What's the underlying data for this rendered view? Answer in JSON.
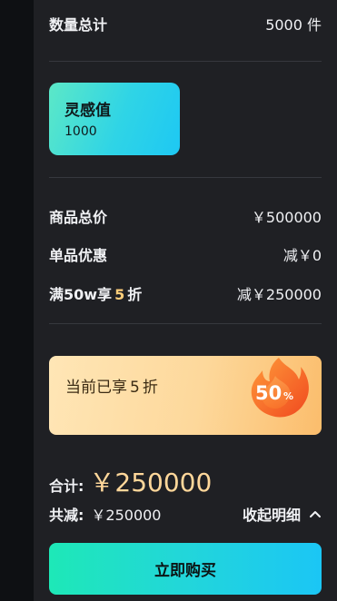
{
  "summary": {
    "quantity_label": "数量总计",
    "quantity_value": "5000 件"
  },
  "inspiration_card": {
    "title": "灵感值",
    "value": "1000"
  },
  "price_rows": {
    "total_label": "商品总价",
    "total_value": "￥500000",
    "single_label": "单品优惠",
    "single_value": "减￥0",
    "promo_prefix": "满50w享",
    "promo_number": "5",
    "promo_suffix": "折",
    "promo_value": "减￥250000"
  },
  "discount_card": {
    "text_prefix": "当前已享",
    "text_number": "5",
    "text_suffix": "折",
    "badge_value": "50",
    "badge_unit": "%"
  },
  "totals": {
    "total_label": "合计:",
    "total_amount": "￥250000",
    "saved_label": "共减:",
    "saved_amount": "￥250000",
    "collapse_label": "收起明细"
  },
  "buy_button_label": "立即购买",
  "colors": {
    "panel_bg": "#1f2024",
    "accent_gold": "#ffd79a",
    "button_gradient_start": "#1ee8b7",
    "button_gradient_end": "#1bc6f5"
  },
  "icons": {
    "collapse": "chevron-up-icon",
    "badge": "flame-badge-icon"
  }
}
